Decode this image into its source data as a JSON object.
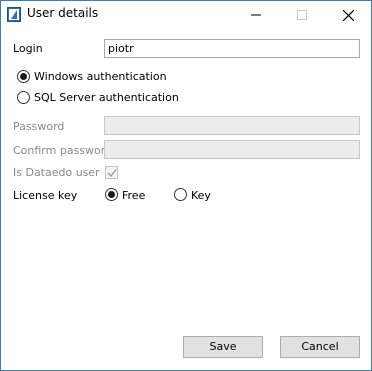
{
  "window": {
    "title": "User details",
    "controls": [
      "minimize",
      "maximize",
      "close"
    ]
  },
  "form": {
    "login_label": "Login",
    "login_value": "piotr",
    "auth": {
      "windows_label": "Windows authentication",
      "sql_label": "SQL Server authentication",
      "selected": "windows"
    },
    "password_label": "Password",
    "password_value": "",
    "confirm_password_label": "Confirm password",
    "confirm_password_value": "",
    "is_dataedo_user_label": "Is Dataedo user",
    "is_dataedo_user_checked": true,
    "license_key_label": "License key",
    "license": {
      "free_label": "Free",
      "key_label": "Key",
      "selected": "free"
    }
  },
  "buttons": {
    "save_label": "Save",
    "cancel_label": "Cancel"
  },
  "icons": {
    "app": "dataedo-app-icon",
    "minimize": "minimize-icon",
    "maximize": "maximize-icon",
    "close": "close-icon",
    "check": "checkmark-icon"
  },
  "colors": {
    "window_border": "#3c7fb1",
    "disabled_text": "#8a8a8a",
    "disabled_field": "#ececec",
    "button_face": "#e1e1e1"
  }
}
